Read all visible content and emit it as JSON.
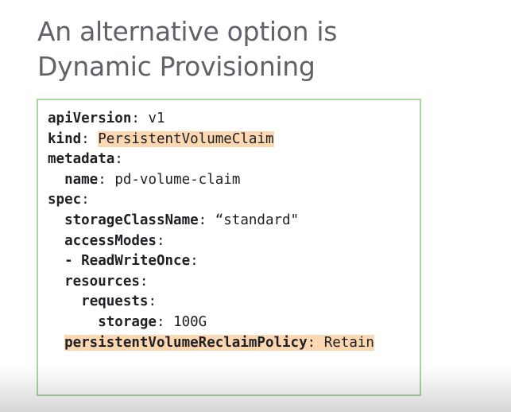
{
  "slide": {
    "title_line1": "An alternative option is",
    "title_line2": "Dynamic Provisioning"
  },
  "code": {
    "lines": [
      {
        "indent": "",
        "key": "apiVersion",
        "sep": ":",
        "value": " v1"
      },
      {
        "indent": "",
        "key": "kind",
        "sep": ":",
        "value": "PersistentVolumeClaim"
      },
      {
        "indent": "",
        "key": "metadata",
        "sep": ":",
        "value": ""
      },
      {
        "indent": "  ",
        "key": "name",
        "sep": ":",
        "value": " pd-volume-claim"
      },
      {
        "indent": "",
        "key": "spec",
        "sep": ":",
        "value": ""
      },
      {
        "indent": "  ",
        "key": "storageClassName",
        "sep": ":",
        "value": " “standard\""
      },
      {
        "indent": "  ",
        "key": "accessModes",
        "sep": ":",
        "value": ""
      },
      {
        "indent": "  ",
        "key": "- ReadWriteOnce",
        "sep": ":",
        "value": ""
      },
      {
        "indent": "  ",
        "key": "resources",
        "sep": ":",
        "value": ""
      },
      {
        "indent": "    ",
        "key": "requests",
        "sep": ":",
        "value": ""
      },
      {
        "indent": "      ",
        "key": "storage",
        "sep": ":",
        "value": " 100G"
      },
      {
        "indent": "  ",
        "key": "persistentVolumeReclaimPolicy",
        "sep": ":",
        "value": " Retain"
      }
    ],
    "highlight_color": "#fbd7b2",
    "border_color": "#a8d5a2"
  }
}
